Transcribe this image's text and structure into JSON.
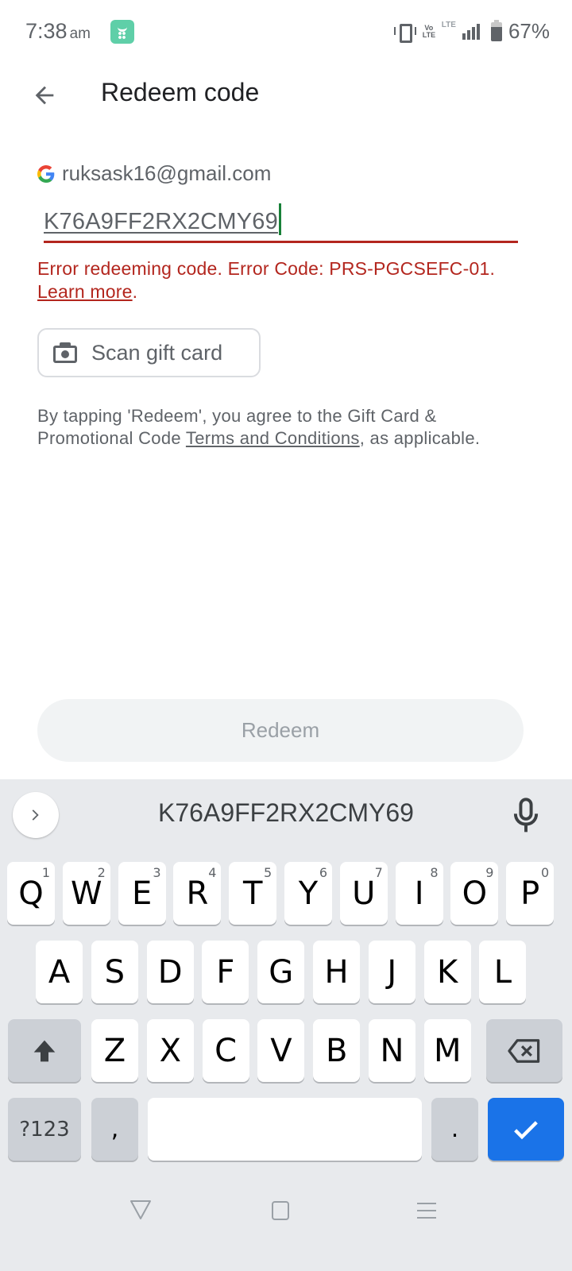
{
  "status_bar": {
    "time": "7:38",
    "ampm": "am",
    "app_icon": "notification-app-icon",
    "icons": [
      "vibrate-icon",
      "volte-icon",
      "lte-icon",
      "signal-icon",
      "battery-icon"
    ],
    "volte_label": "Vo LTE",
    "lte_label": "LTE",
    "battery_percent": "67%",
    "battery_level": 0.67
  },
  "app_bar": {
    "back_icon": "arrow-back-icon",
    "title": "Redeem code"
  },
  "account": {
    "icon": "google-g-icon",
    "email": "ruksask16@gmail.com"
  },
  "code_input": {
    "value": "K76A9FF2RX2CMY69",
    "state": "error",
    "colors": {
      "error": "#b3261e",
      "caret": "#188038"
    }
  },
  "error": {
    "message": "Error redeeming code. Error Code: PRS-PGCSEFC-01.",
    "link_label": "Learn more",
    "trailing": "."
  },
  "scan_button": {
    "icon": "camera-icon",
    "label": "Scan gift card"
  },
  "terms": {
    "prefix": "By tapping 'Redeem', you agree to the Gift Card & Promotional Code ",
    "link_label": "Terms and Conditions",
    "suffix": ", as applicable."
  },
  "redeem_button": {
    "label": "Redeem",
    "enabled": false
  },
  "keyboard": {
    "suggestion": "K76A9FF2RX2CMY69",
    "expand_icon": "chevron-right-icon",
    "mic_icon": "microphone-icon",
    "row1": [
      {
        "key": "Q",
        "hint": "1"
      },
      {
        "key": "W",
        "hint": "2"
      },
      {
        "key": "E",
        "hint": "3"
      },
      {
        "key": "R",
        "hint": "4"
      },
      {
        "key": "T",
        "hint": "5"
      },
      {
        "key": "Y",
        "hint": "6"
      },
      {
        "key": "U",
        "hint": "7"
      },
      {
        "key": "I",
        "hint": "8"
      },
      {
        "key": "O",
        "hint": "9"
      },
      {
        "key": "P",
        "hint": "0"
      }
    ],
    "row2": [
      "A",
      "S",
      "D",
      "F",
      "G",
      "H",
      "J",
      "K",
      "L"
    ],
    "row3": [
      "Z",
      "X",
      "C",
      "V",
      "B",
      "N",
      "M"
    ],
    "shift_icon": "shift-icon",
    "backspace_icon": "backspace-icon",
    "symbols_label": "?123",
    "comma_label": ",",
    "period_label": ".",
    "enter_icon": "checkmark-icon",
    "accent_color": "#1a73e8"
  },
  "nav_bar": {
    "back_icon": "nav-back-icon",
    "home_icon": "nav-home-icon",
    "recents_icon": "nav-recents-icon"
  }
}
